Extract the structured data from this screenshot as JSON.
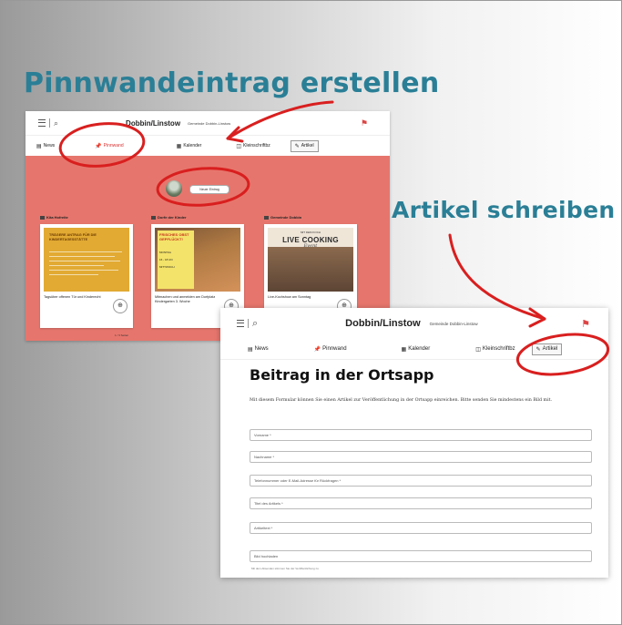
{
  "headings": {
    "left": "Pinnwandeintrag erstellen",
    "right": "Artikel schreiben"
  },
  "app": {
    "title": "Dobbin/Linstow"
  },
  "pinnwand_screen": {
    "location": "Gemeinde Dobbin-Linstow",
    "nav": [
      {
        "label": "News",
        "icon": "newspaper-icon",
        "glyph": "▤"
      },
      {
        "label": "Pinnwand",
        "icon": "pin-icon",
        "glyph": "📌"
      },
      {
        "label": "Kalender",
        "icon": "calendar-icon",
        "glyph": "▦"
      },
      {
        "label": "Kleinschriftbz",
        "icon": "tag-icon",
        "glyph": "◫"
      },
      {
        "label": "Artikel",
        "icon": "edit-icon",
        "glyph": "✎"
      }
    ],
    "post_button": "Neuer Eintrag",
    "cards": [
      {
        "category": "Kita Hofreite",
        "poster_title": "TRÄGERE ANTRAG FÜR DIE KINDERTAGESSTÄTTE",
        "text": "Tagsüber offenen Tür und Kinderecht"
      },
      {
        "category": "Dorfe der Kinder",
        "poster_head": "FRISCHES OBST GEPFLÜCKT!",
        "poster_lines": [
          "MONTAG",
          "16 - 18 Uhr",
          "MITTWOCH"
        ],
        "text": "Mitmachen und anmelden am Dorfplatz Kindergarten 3. Woche"
      },
      {
        "category": "Gemeinde Dobbin",
        "poster_small": "MIT DEM KOCH",
        "poster_title": "LIVE COOKING",
        "poster_script": "Event",
        "text": "Live-Kochshow am Sonntag"
      }
    ],
    "pager": "1 / 3 Seiten"
  },
  "artikel_screen": {
    "location": "Gemeinde Dobbin-Linstow",
    "nav": [
      {
        "label": "News",
        "icon": "newspaper-icon",
        "glyph": "▤"
      },
      {
        "label": "Pinnwand",
        "icon": "pin-icon",
        "glyph": "📌"
      },
      {
        "label": "Kalender",
        "icon": "calendar-icon",
        "glyph": "▦"
      },
      {
        "label": "Kleinschriftbz",
        "icon": "tag-icon",
        "glyph": "◫"
      },
      {
        "label": "Artikel",
        "icon": "edit-icon",
        "glyph": "✎"
      }
    ],
    "form_title": "Beitrag in der Ortsapp",
    "intro": "Mit diesem Formular können Sie einen Artikel zur Veröffentlichung in der Ortsapp einreichen. Bitte senden Sie mindestens ein Bild mit.",
    "fields": [
      "Vorname *",
      "Nachname *",
      "Telefonnummer oder E-Mail-Adresse für Rückfragen *",
      "Titel des Artikels *",
      "Artikeltext *",
      "Bild hochladen"
    ],
    "footer": "Mit dem Absenden stimmen Sie der Veröffentlichung zu."
  },
  "colors": {
    "heading": "#2a7f96",
    "pinnwand_bg": "#e6766d",
    "annotation_red": "#d91f1f"
  }
}
